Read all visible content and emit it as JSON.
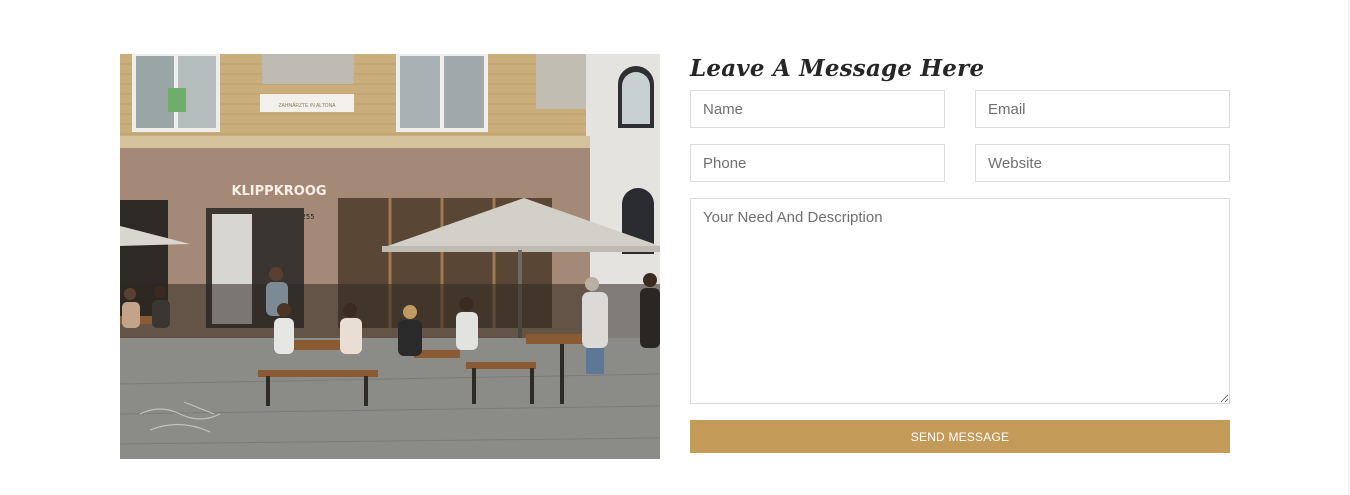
{
  "photo": {
    "storefront_sign": "KLIPPKROOG",
    "house_number": "255",
    "upper_sign": "ZAHNÄRZTE IN ALTONA"
  },
  "form": {
    "heading": "Leave A Message Here",
    "name_placeholder": "Name",
    "email_placeholder": "Email",
    "phone_placeholder": "Phone",
    "website_placeholder": "Website",
    "description_placeholder": "Your Need And Description",
    "send_label": "SEND MESSAGE"
  },
  "colors": {
    "accent": "#c49a58",
    "heading": "#262626",
    "border": "#dcdcdc"
  }
}
